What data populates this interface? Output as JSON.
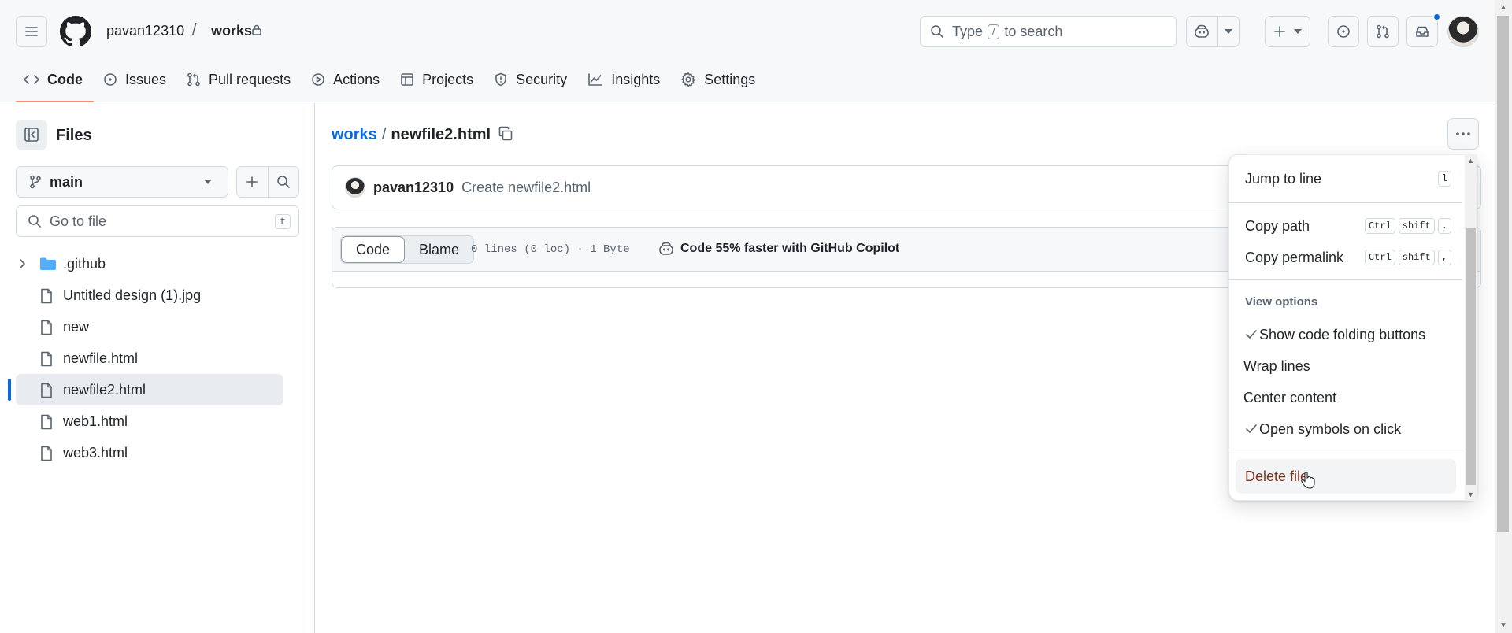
{
  "header": {
    "owner": "pavan12310",
    "separator": "/",
    "repo": "works",
    "search_prefix": "Type",
    "search_key": "/",
    "search_suffix": "to search"
  },
  "nav": {
    "tabs": [
      {
        "label": "Code",
        "icon": "code-icon"
      },
      {
        "label": "Issues",
        "icon": "issue-icon"
      },
      {
        "label": "Pull requests",
        "icon": "pull-request-icon"
      },
      {
        "label": "Actions",
        "icon": "play-icon"
      },
      {
        "label": "Projects",
        "icon": "table-icon"
      },
      {
        "label": "Security",
        "icon": "shield-icon"
      },
      {
        "label": "Insights",
        "icon": "graph-icon"
      },
      {
        "label": "Settings",
        "icon": "gear-icon"
      }
    ]
  },
  "sidebar": {
    "title": "Files",
    "branch": "main",
    "goto_placeholder": "Go to file",
    "goto_key": "t",
    "items": [
      {
        "label": ".github",
        "type": "folder"
      },
      {
        "label": "Untitled design (1).jpg",
        "type": "file"
      },
      {
        "label": "new",
        "type": "file"
      },
      {
        "label": "newfile.html",
        "type": "file"
      },
      {
        "label": "newfile2.html",
        "type": "file",
        "selected": true
      },
      {
        "label": "web1.html",
        "type": "file"
      },
      {
        "label": "web3.html",
        "type": "file"
      }
    ]
  },
  "main": {
    "repo_link": "works",
    "separator": "/",
    "filename": "newfile2.html",
    "commit_user": "pavan12310",
    "commit_message": "Create newfile2.html",
    "code_tab": "Code",
    "blame_tab": "Blame",
    "file_meta": "0 lines (0 loc) · 1 Byte",
    "copilot_text": "Code 55% faster with GitHub Copilot"
  },
  "menu": {
    "jump_label": "Jump to line",
    "jump_key": "l",
    "copy_path": "Copy path",
    "copy_permalink": "Copy permalink",
    "key_ctrl": "Ctrl",
    "key_shift": "shift",
    "key_period": ".",
    "key_comma": ",",
    "view_options": "View options",
    "show_folding": "Show code folding buttons",
    "wrap_lines": "Wrap lines",
    "center_content": "Center content",
    "open_symbols": "Open symbols on click",
    "delete_file": "Delete file"
  },
  "colors": {
    "accent": "#0969da",
    "tab_underline": "#fd8c73",
    "danger": "#82301e"
  }
}
